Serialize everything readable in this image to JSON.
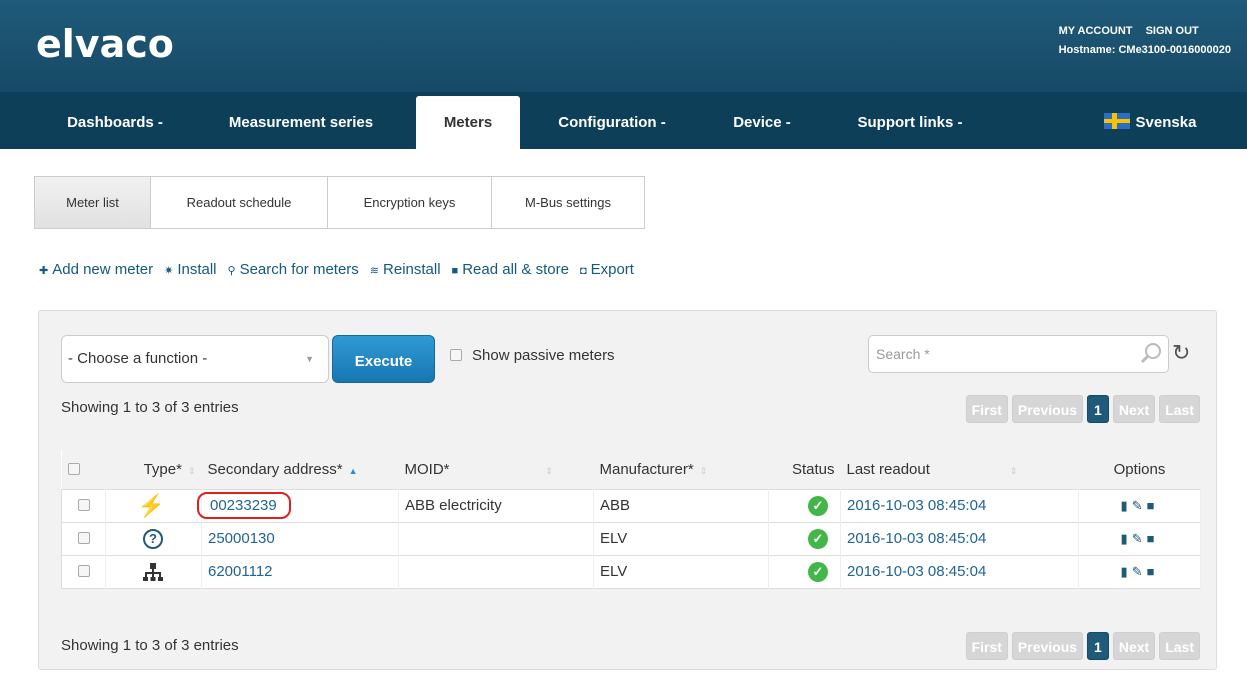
{
  "brand": {
    "logo": "elvaco"
  },
  "account": {
    "my_account": "MY ACCOUNT",
    "sign_out": "SIGN OUT",
    "hostname": "Hostname: CMe3100-0016000020"
  },
  "nav": {
    "dashboards": "Dashboards -",
    "measurement": "Measurement series",
    "meters": "Meters",
    "configuration": "Configuration -",
    "device": "Device -",
    "support": "Support links -",
    "language": "Svenska"
  },
  "subtabs": {
    "meter_list": "Meter list",
    "readout_schedule": "Readout schedule",
    "encryption_keys": "Encryption keys",
    "mbus_settings": "M-Bus settings"
  },
  "actions": {
    "add": "Add new meter",
    "install": "Install",
    "search": "Search for meters",
    "reinstall": "Reinstall",
    "read_all": "Read all & store",
    "export": "Export"
  },
  "toolbar": {
    "function_select": "- Choose a function -",
    "execute": "Execute",
    "passive": "Show passive meters",
    "search_placeholder": "Search *"
  },
  "info": {
    "top": "Showing 1 to 3 of 3 entries",
    "bottom": "Showing 1 to 3 of 3 entries"
  },
  "pager": {
    "first": "First",
    "previous": "Previous",
    "current": "1",
    "next": "Next",
    "last": "Last"
  },
  "table": {
    "headers": {
      "type": "Type*",
      "secondary": "Secondary address*",
      "moid": "MOID*",
      "manufacturer": "Manufacturer*",
      "status": "Status",
      "last_readout": "Last readout",
      "options": "Options"
    },
    "rows": [
      {
        "type_icon": "lightning-icon",
        "secondary": "00233239",
        "moid": "ABB electricity",
        "manufacturer": "ABB",
        "status": "ok",
        "last_readout": "2016-10-03 08:45:04"
      },
      {
        "type_icon": "question-icon",
        "secondary": "25000130",
        "moid": "",
        "manufacturer": "ELV",
        "status": "ok",
        "last_readout": "2016-10-03 08:45:04"
      },
      {
        "type_icon": "network-icon",
        "secondary": "62001112",
        "moid": "",
        "manufacturer": "ELV",
        "status": "ok",
        "last_readout": "2016-10-03 08:45:04"
      }
    ]
  },
  "colors": {
    "header": "#1f5a7a",
    "nav": "#0d3f58",
    "link": "#1f6397",
    "ok": "#43b649",
    "highlight": "#e02020"
  }
}
